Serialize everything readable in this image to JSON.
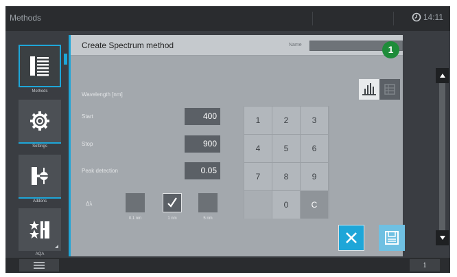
{
  "topbar": {
    "title": "Methods",
    "clock": "14:11"
  },
  "sidebar": {
    "items": [
      {
        "label": "Methods",
        "icon": "methods-list-icon",
        "active": true
      },
      {
        "label": "Settings",
        "icon": "gear-icon"
      },
      {
        "label": "Addons",
        "icon": "addons-icon"
      },
      {
        "label": "AQA",
        "icon": "aqa-icon"
      }
    ]
  },
  "panel": {
    "title": "Create Spectrum method",
    "name_label": "Name",
    "name_value": "",
    "wavelength_label": "Wavelength [nm]",
    "fields": [
      {
        "label": "Start",
        "value": "400"
      },
      {
        "label": "Stop",
        "value": "900"
      },
      {
        "label": "Peak detection",
        "value": "0.05"
      }
    ],
    "step": {
      "label": "Δλ",
      "options": [
        {
          "label": "0.1 nm",
          "checked": false
        },
        {
          "label": "1 nm",
          "checked": true
        },
        {
          "label": "5 nm",
          "checked": false
        }
      ]
    }
  },
  "keypad": {
    "keys": [
      "1",
      "2",
      "3",
      "4",
      "5",
      "6",
      "7",
      "8",
      "9",
      "",
      "0",
      "C"
    ]
  },
  "callout": {
    "number": "1"
  },
  "bottombar": {
    "info_label": "i"
  },
  "colors": {
    "accent": "#1ea6d8",
    "callout": "#1e8c3a",
    "panel": "#a3a8ad"
  }
}
